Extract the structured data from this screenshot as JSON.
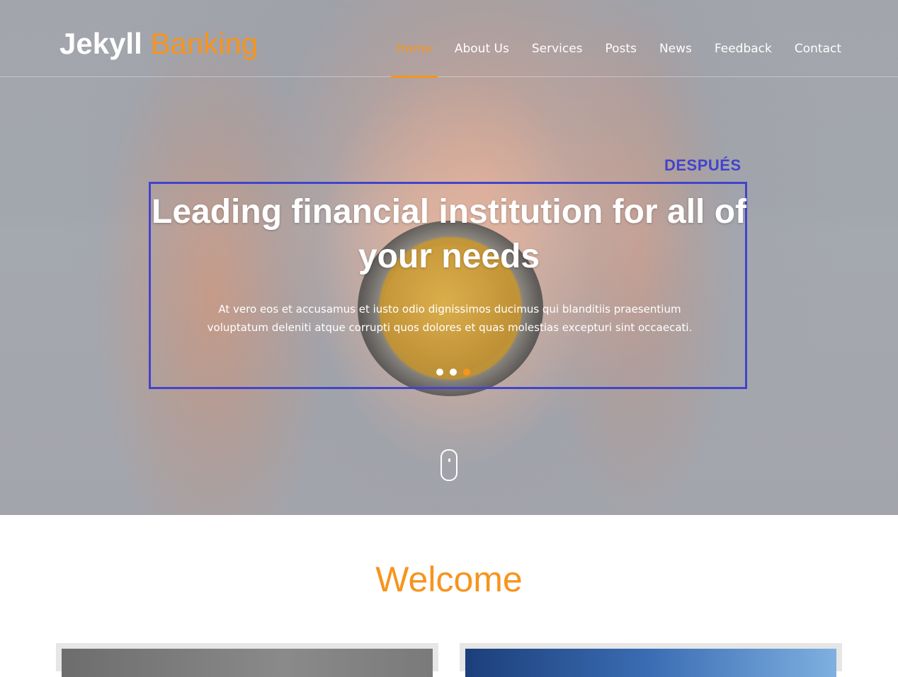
{
  "header": {
    "logo_part1": "Jekyll",
    "logo_part2": "Banking",
    "nav": [
      {
        "label": "Home",
        "active": true
      },
      {
        "label": "About Us",
        "active": false
      },
      {
        "label": "Services",
        "active": false
      },
      {
        "label": "Posts",
        "active": false
      },
      {
        "label": "News",
        "active": false
      },
      {
        "label": "Feedback",
        "active": false
      },
      {
        "label": "Contact",
        "active": false
      }
    ]
  },
  "annotation": {
    "label": "DESPUÉS"
  },
  "hero": {
    "title": "Leading financial institution for all of your needs",
    "text": "At vero eos et accusamus et iusto odio dignissimos ducimus qui blanditiis praesentium voluptatum deleniti atque corrupti quos dolores et quas molestias excepturi sint occaecati.",
    "slides": {
      "count": 3,
      "active_index": 2
    }
  },
  "welcome": {
    "title": "Welcome"
  },
  "colors": {
    "accent": "#f7941d",
    "annotation": "#4343cc",
    "text_light": "#ffffff"
  }
}
